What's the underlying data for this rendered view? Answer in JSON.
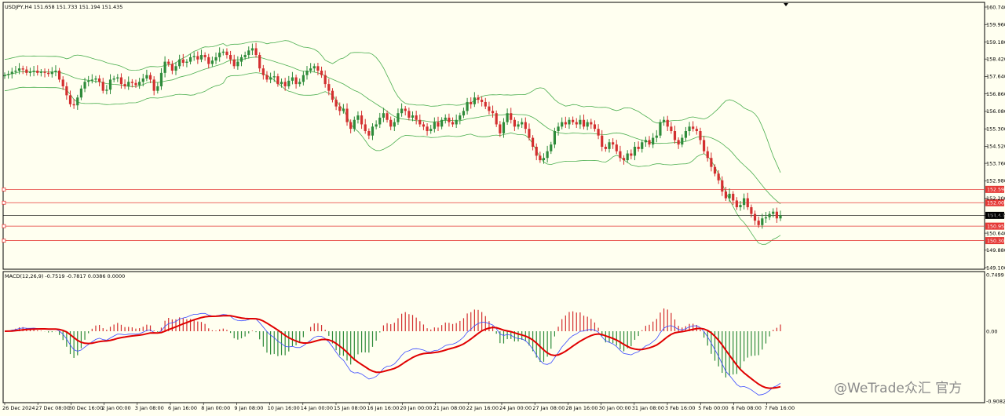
{
  "header": {
    "symbol_info": "USDJPY,H4  151.658 151.733 151.194 151.435",
    "macd_info": "MACD(12,26,9) -0.7519 -0.7817 0.0386 0.0000"
  },
  "watermark": "@WeTrade众汇 官方",
  "colors": {
    "background": "#fffff0",
    "bull": "#2e8b3a",
    "bear": "#d32f2f",
    "bands": "#4caf50",
    "hline": "#e53935",
    "macd_signal": "#e00000",
    "macd_line": "#3949ff"
  },
  "price_axis_labels": [
    "160.740",
    "159.960",
    "159.180",
    "158.420",
    "157.640",
    "156.860",
    "156.080",
    "155.300",
    "154.520",
    "153.760",
    "152.980",
    "152.200",
    "151.435",
    "150.640",
    "149.880",
    "149.100"
  ],
  "macd_axis_labels": [
    "0.7499",
    "0.00",
    "-0.9082"
  ],
  "time_labels": [
    "26 Dec 2024",
    "27 Dec 08:00",
    "30 Dec 16:00",
    "2 Jan 00:00",
    "3 Jan 08:00",
    "6 Jan 16:00",
    "8 Jan 00:00",
    "9 Jan 08:00",
    "10 Jan 16:00",
    "14 Jan 00:00",
    "15 Jan 08:00",
    "16 Jan 16:00",
    "20 Jan 00:00",
    "21 Jan 08:00",
    "22 Jan 16:00",
    "24 Jan 00:00",
    "27 Jan 08:00",
    "28 Jan 16:00",
    "30 Jan 00:00",
    "31 Jan 08:00",
    "3 Feb 16:00",
    "5 Feb 00:00",
    "6 Feb 08:00",
    "7 Feb 16:00"
  ],
  "chart_data": [
    {
      "type": "candlestick",
      "symbol": "USDJPY",
      "timeframe": "H4",
      "ylim": [
        149.1,
        160.74
      ],
      "last_price": 151.435,
      "horizontal_levels": [
        {
          "label": "152.594",
          "value": 152.594
        },
        {
          "label": "152.001",
          "value": 152.001
        },
        {
          "label": "150.954",
          "value": 150.954
        },
        {
          "label": "150.307",
          "value": 150.307
        }
      ],
      "close_series": [
        157.7,
        157.75,
        157.85,
        157.9,
        158.0,
        157.95,
        157.8,
        157.85,
        157.9,
        157.8,
        157.85,
        157.8,
        157.75,
        157.85,
        157.9,
        157.5,
        157.2,
        156.8,
        156.4,
        156.35,
        156.7,
        157.1,
        157.4,
        157.45,
        157.5,
        157.55,
        157.4,
        157.0,
        157.05,
        157.5,
        157.55,
        157.6,
        157.3,
        157.2,
        157.4,
        157.35,
        157.25,
        157.4,
        157.55,
        157.7,
        157.5,
        157.0,
        157.2,
        157.8,
        158.3,
        158.2,
        157.9,
        158.1,
        158.4,
        158.25,
        158.3,
        158.5,
        158.55,
        158.4,
        158.6,
        158.5,
        158.2,
        158.35,
        158.5,
        158.7,
        158.75,
        158.6,
        158.4,
        158.1,
        158.3,
        158.5,
        158.6,
        158.8,
        158.9,
        158.6,
        158.0,
        157.7,
        157.5,
        157.6,
        157.65,
        157.3,
        157.4,
        157.2,
        157.45,
        157.6,
        157.3,
        157.4,
        157.7,
        157.9,
        158.0,
        158.1,
        157.9,
        157.7,
        157.3,
        157.0,
        156.6,
        156.3,
        156.1,
        156.2,
        155.6,
        155.3,
        155.7,
        155.9,
        155.5,
        155.2,
        155.0,
        155.4,
        155.5,
        155.8,
        156.0,
        155.7,
        155.4,
        155.6,
        156.0,
        156.2,
        156.1,
        155.8,
        155.9,
        155.7,
        155.5,
        155.4,
        155.2,
        155.3,
        155.6,
        155.4,
        155.7,
        155.8,
        155.6,
        155.5,
        155.7,
        155.9,
        156.1,
        156.5,
        156.4,
        156.7,
        156.6,
        156.5,
        156.3,
        156.1,
        156.0,
        155.5,
        155.1,
        155.6,
        156.0,
        155.7,
        155.4,
        155.5,
        155.6,
        155.3,
        154.9,
        154.5,
        154.1,
        153.9,
        154.0,
        154.3,
        154.6,
        155.2,
        155.4,
        155.6,
        155.5,
        155.7,
        155.6,
        155.5,
        155.7,
        155.4,
        155.6,
        155.5,
        155.3,
        155.0,
        154.5,
        154.4,
        154.7,
        154.6,
        154.3,
        154.0,
        153.9,
        154.2,
        154.1,
        154.5,
        154.4,
        154.7,
        154.8,
        154.6,
        154.9,
        155.0,
        155.6,
        155.7,
        155.4,
        155.2,
        154.8,
        154.6,
        154.9,
        155.2,
        155.4,
        155.3,
        155.2,
        154.8,
        154.3,
        154.0,
        153.6,
        153.3,
        153.0,
        152.5,
        152.2,
        152.4,
        152.1,
        151.8,
        151.9,
        152.2,
        151.8,
        151.5,
        151.2,
        151.0,
        151.3,
        151.35,
        151.5,
        151.6,
        151.3,
        151.435
      ]
    },
    {
      "type": "macd",
      "params": "12,26,9",
      "ylim": [
        -0.9082,
        0.7499
      ],
      "values": {
        "macd": -0.7519,
        "signal": -0.7817,
        "histogram": 0.0386
      }
    }
  ]
}
